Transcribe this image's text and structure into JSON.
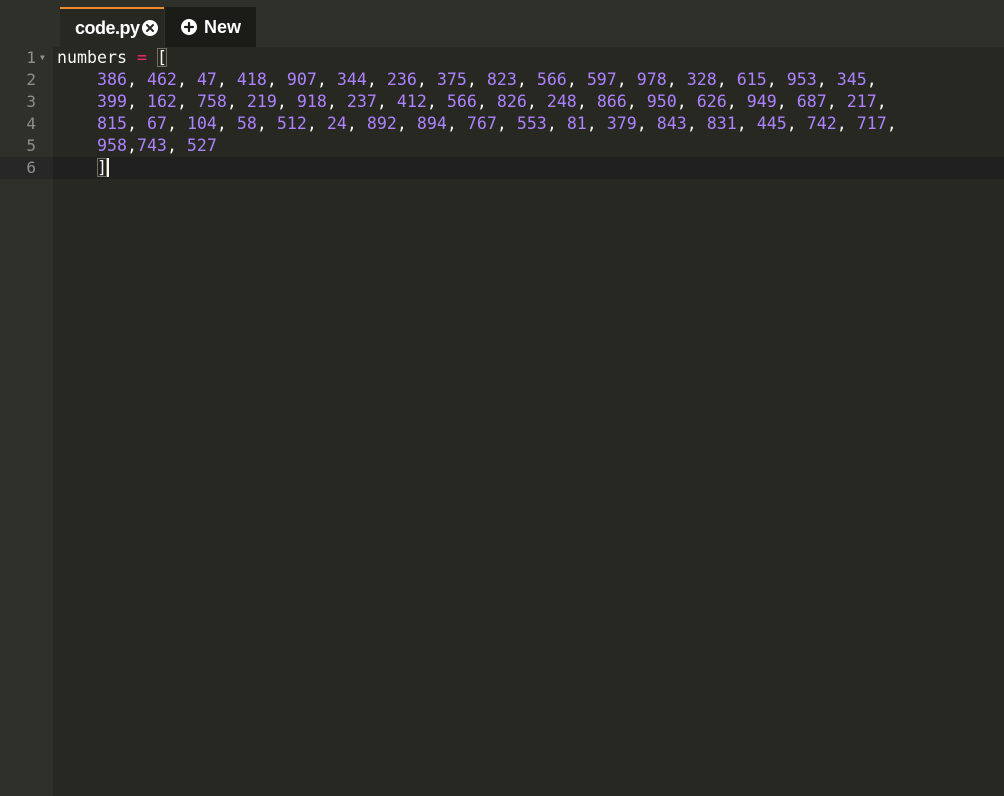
{
  "tabs": [
    {
      "label": "code.py",
      "active": true
    },
    {
      "label": "New",
      "active": false
    }
  ],
  "editor": {
    "line_numbers": [
      "1",
      "2",
      "3",
      "4",
      "5",
      "6"
    ],
    "line1": {
      "ident": "numbers",
      "op": "=",
      "bracket": "["
    },
    "line2_numbers": [
      "386",
      "462",
      "47",
      "418",
      "907",
      "344",
      "236",
      "375",
      "823",
      "566",
      "597",
      "978",
      "328",
      "615",
      "953",
      "345"
    ],
    "line3_numbers": [
      "399",
      "162",
      "758",
      "219",
      "918",
      "237",
      "412",
      "566",
      "826",
      "248",
      "866",
      "950",
      "626",
      "949",
      "687",
      "217"
    ],
    "line4_numbers": [
      "815",
      "67",
      "104",
      "58",
      "512",
      "24",
      "892",
      "894",
      "767",
      "553",
      "81",
      "379",
      "843",
      "831",
      "445",
      "742",
      "717"
    ],
    "line5": {
      "n1": "958",
      "n2": "743",
      "n3": "527"
    },
    "line6": {
      "bracket": "]"
    }
  },
  "colors": {
    "background": "#272822",
    "gutter": "#2f302a",
    "number": "#ae81ff",
    "operator": "#f92672",
    "text": "#f8f8f2",
    "tab_accent": "#f18a2c"
  },
  "icons": {
    "close": "close-circle-icon",
    "new": "plus-circle-icon",
    "fold": "fold-arrow-icon"
  }
}
